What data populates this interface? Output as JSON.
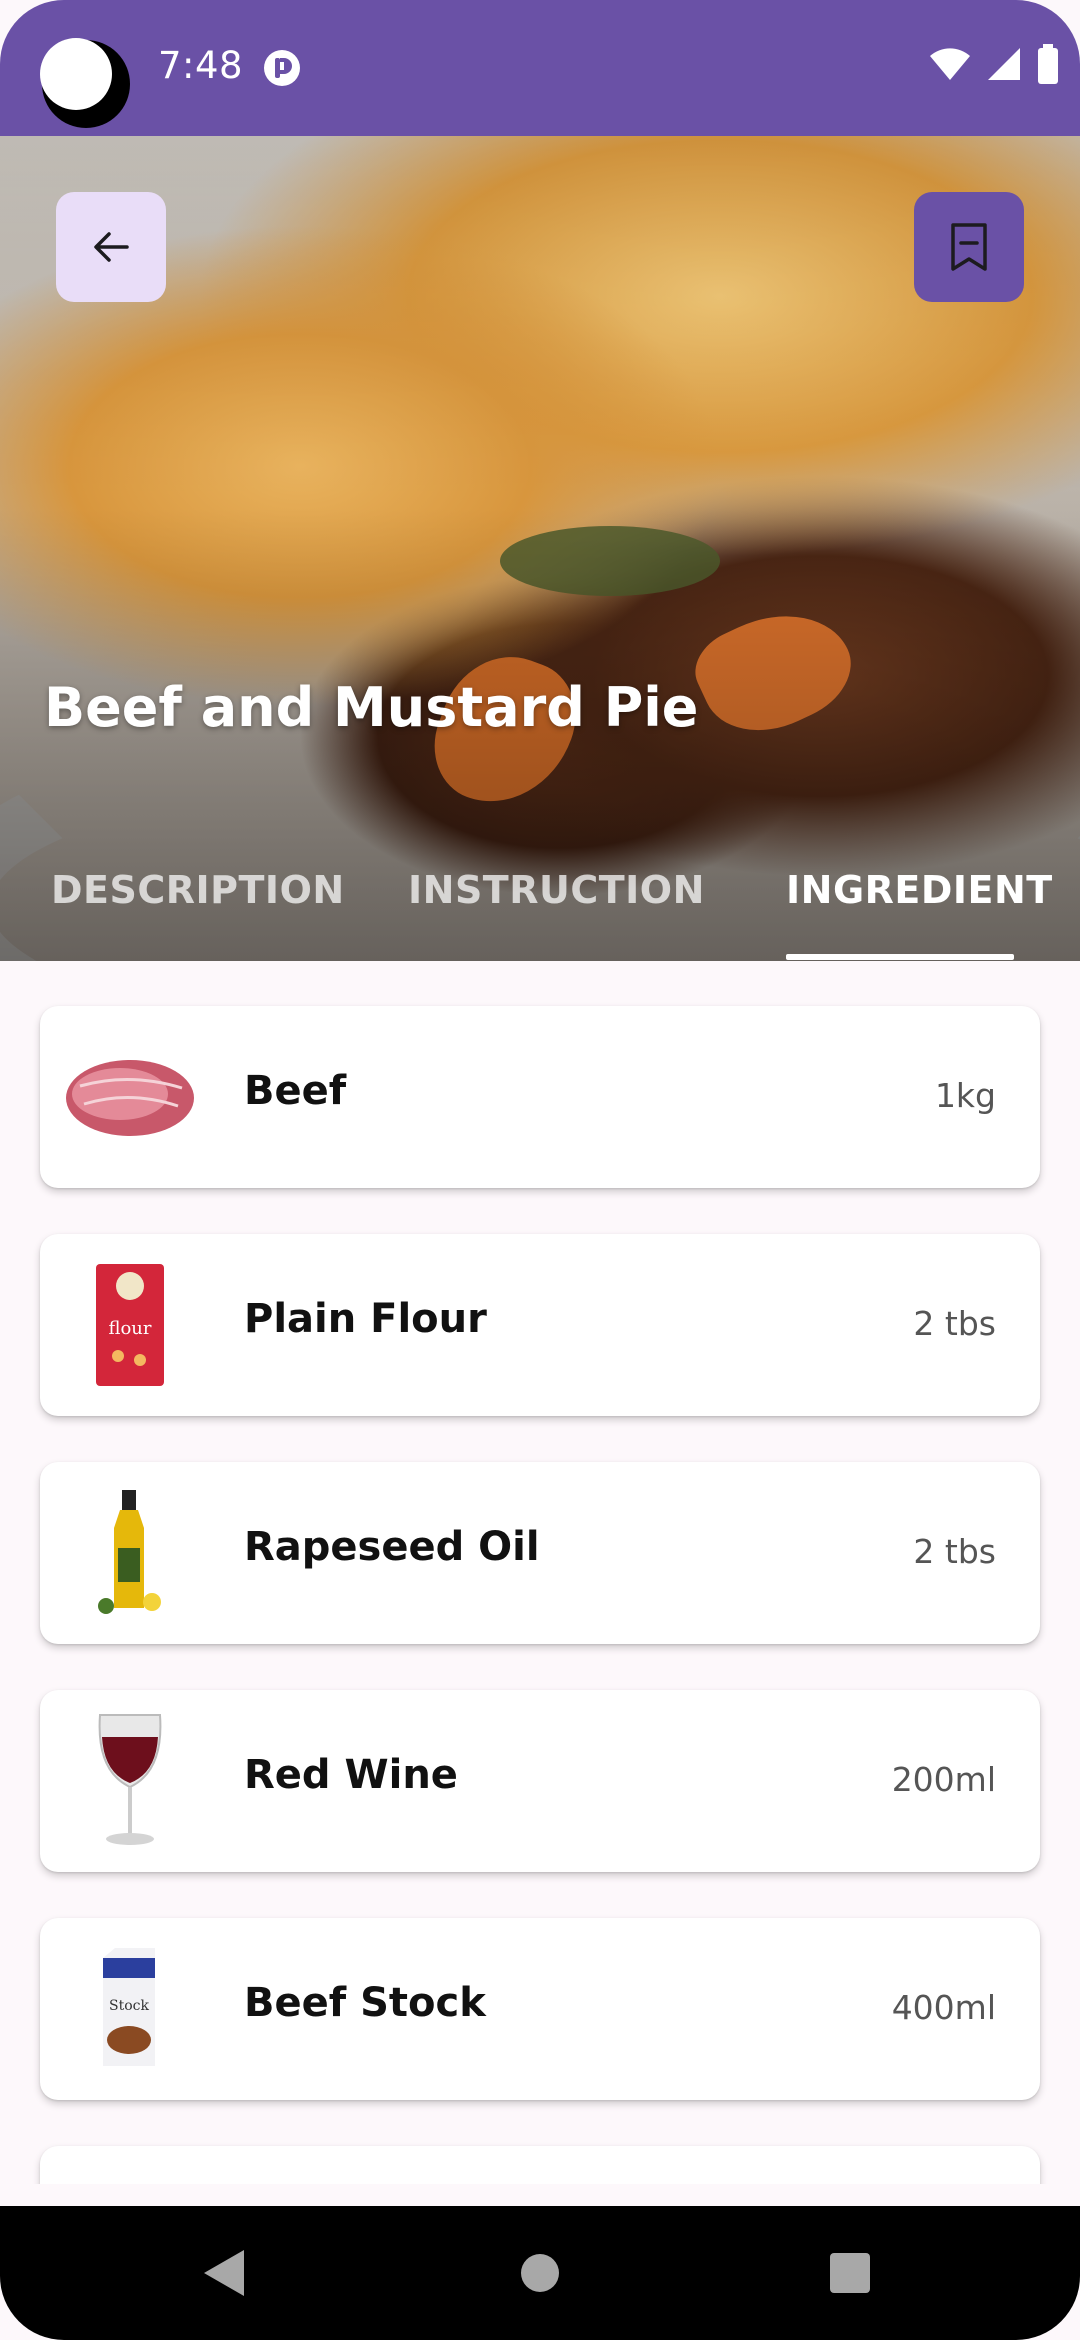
{
  "status_bar": {
    "time": "7:48",
    "bg_color": "#6a51a6",
    "icons": [
      "app-notification-icon",
      "wifi-icon",
      "signal-icon",
      "battery-icon"
    ]
  },
  "hero": {
    "title": "Beef and Mustard Pie",
    "back_icon": "arrow-left-icon",
    "bookmark_icon": "bookmark-icon"
  },
  "tabs": [
    {
      "label": "DESCRIPTION",
      "active": false
    },
    {
      "label": "INSTRUCTION",
      "active": false
    },
    {
      "label": "INGREDIENT",
      "active": true
    }
  ],
  "ingredients": [
    {
      "name": "Beef",
      "quantity": "1kg",
      "icon": "beef-image"
    },
    {
      "name": "Plain Flour",
      "quantity": "2 tbs",
      "icon": "flour-bag-image"
    },
    {
      "name": "Rapeseed Oil",
      "quantity": "2 tbs",
      "icon": "oil-bottle-image"
    },
    {
      "name": "Red Wine",
      "quantity": "200ml",
      "icon": "wine-glass-image"
    },
    {
      "name": "Beef Stock",
      "quantity": "400ml",
      "icon": "stock-carton-image"
    }
  ],
  "nav_bar": {
    "icons": [
      "nav-back-icon",
      "nav-home-icon",
      "nav-recents-icon"
    ]
  },
  "colors": {
    "accent": "#6a51a6",
    "accent_light": "#e9ddf8",
    "background": "#fdf8fb"
  }
}
